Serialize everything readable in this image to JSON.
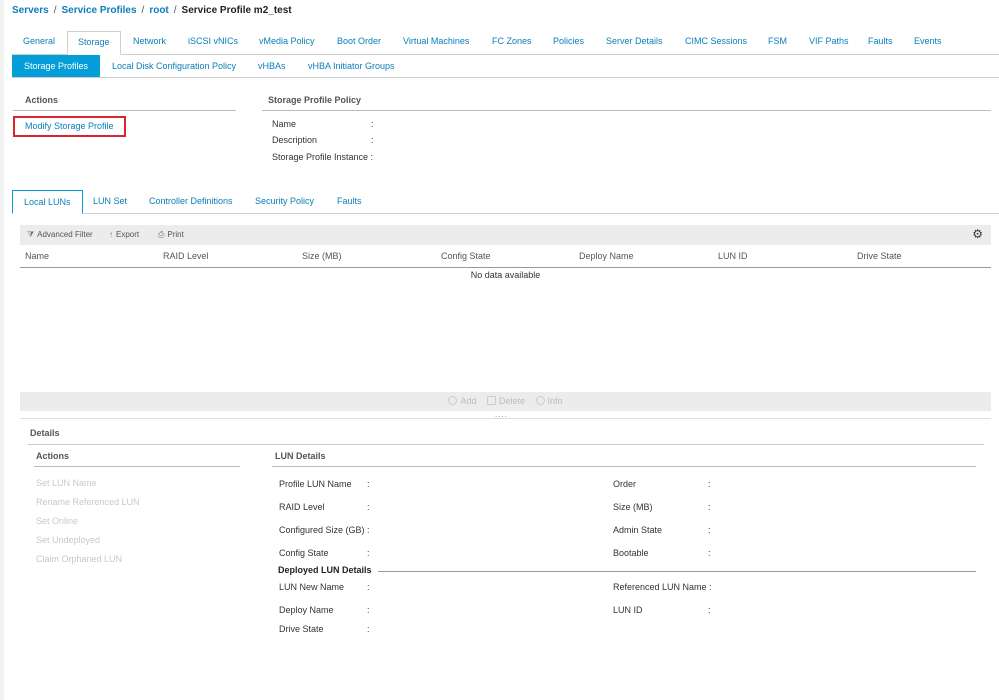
{
  "breadcrumb": {
    "servers": "Servers",
    "service_profiles": "Service Profiles",
    "root": "root",
    "current": "Service Profile m2_test",
    "sep": "/"
  },
  "tabs": [
    "General",
    "Storage",
    "Network",
    "iSCSI vNICs",
    "vMedia Policy",
    "Boot Order",
    "Virtual Machines",
    "FC Zones",
    "Policies",
    "Server Details",
    "CIMC Sessions",
    "FSM",
    "VIF Paths",
    "Faults",
    "Events"
  ],
  "subtabs": [
    "Storage Profiles",
    "Local Disk Configuration Policy",
    "vHBAs",
    "vHBA Initiator Groups"
  ],
  "actions": {
    "header": "Actions",
    "modify": "Modify Storage Profile"
  },
  "policy": {
    "header": "Storage Profile Policy",
    "name": "Name",
    "description": "Description",
    "instance": "Storage Profile Instance :",
    "colon": ":"
  },
  "lun_tabs": [
    "Local LUNs",
    "LUN Set",
    "Controller Definitions",
    "Security Policy",
    "Faults"
  ],
  "toolbar": {
    "filter": "Advanced Filter",
    "export": "Export",
    "print": "Print",
    "filter_icon": "filter-icon",
    "export_icon": "export-icon",
    "print_icon": "print-icon",
    "settings_icon": "gear-icon"
  },
  "table": {
    "columns": [
      "Name",
      "RAID Level",
      "Size (MB)",
      "Config State",
      "Deploy Name",
      "LUN ID",
      "Drive State"
    ],
    "empty": "No data available"
  },
  "bottombar": {
    "add": "Add",
    "delete": "Delete",
    "info": "Info",
    "grip": "....",
    "add_icon": "add-icon",
    "delete_icon": "trash-icon",
    "info_icon": "info-icon"
  },
  "details": {
    "header": "Details",
    "actions_header": "Actions",
    "actions": [
      "Set LUN Name",
      "Rename Referenced LUN",
      "Set Online",
      "Set Undeployed",
      "Claim Orphaned LUN"
    ],
    "lun_header": "LUN Details",
    "profile_lun_name": "Profile LUN Name",
    "raid_level": "RAID Level",
    "configured_size": "Configured Size (GB) :",
    "config_state": "Config State",
    "order": "Order",
    "size_mb": "Size (MB)",
    "admin_state": "Admin State",
    "bootable": "Bootable",
    "deployed_header": "Deployed LUN Details",
    "lun_new_name": "LUN New Name",
    "referenced_lun_name": "Referenced LUN Name :",
    "deploy_name": "Deploy Name",
    "lun_id": "LUN ID",
    "drive_state": "Drive State",
    "colon": ":"
  }
}
